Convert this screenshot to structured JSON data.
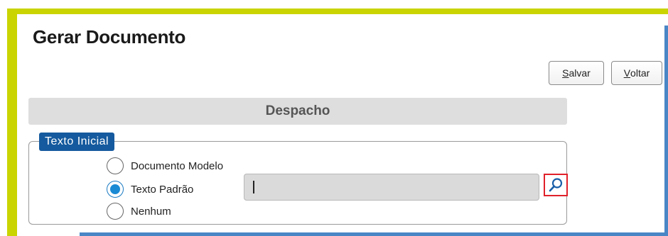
{
  "page": {
    "title": "Gerar Documento"
  },
  "toolbar": {
    "save_label": "Salvar",
    "save_mnemonic": "S",
    "save_rest": "alvar",
    "back_label": "Voltar",
    "back_mnemonic": "V",
    "back_rest": "oltar"
  },
  "section": {
    "header": "Despacho"
  },
  "texto_inicial": {
    "legend": "Texto Inicial",
    "options": [
      {
        "label": "Documento Modelo",
        "checked": false
      },
      {
        "label": "Texto Padrão",
        "checked": true
      },
      {
        "label": "Nenhum",
        "checked": false
      }
    ],
    "input_value": ""
  },
  "colors": {
    "accent_lime": "#c9d400",
    "accent_blue": "#4a86c5",
    "legend_bg": "#155a9e",
    "highlight_red": "#e0202a",
    "radio_selected": "#1a8ad4"
  },
  "icons": {
    "search": "magnifier-icon"
  }
}
